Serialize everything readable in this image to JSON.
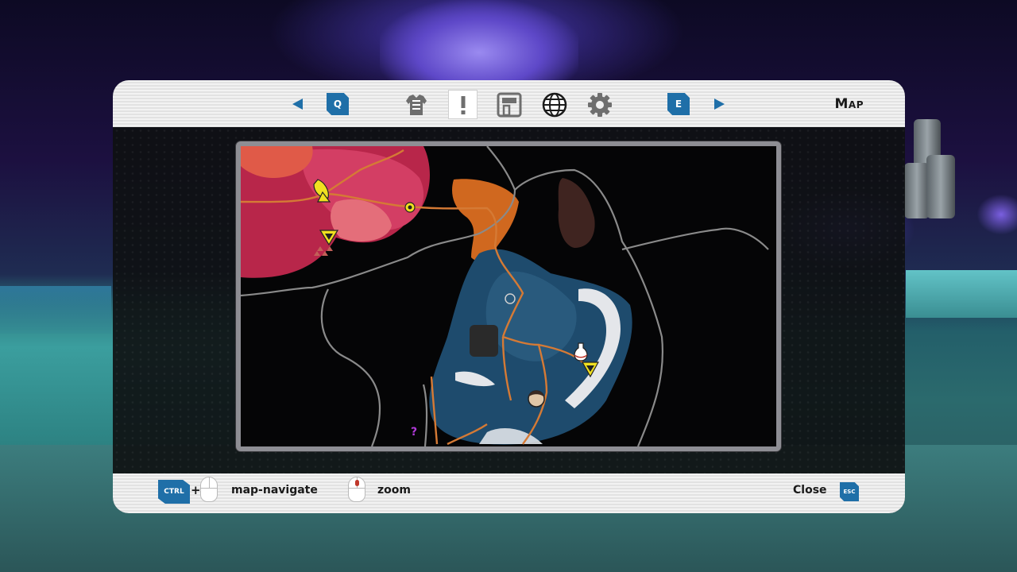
{
  "header": {
    "prev_key": "Q",
    "next_key": "E",
    "title": "Map",
    "tabs": [
      {
        "icon": "armor-icon",
        "active": false
      },
      {
        "icon": "exclamation-icon",
        "active": true
      },
      {
        "icon": "base-icon",
        "active": false
      },
      {
        "icon": "globe-icon",
        "active": false
      },
      {
        "icon": "gear-icon",
        "active": false
      }
    ]
  },
  "footer": {
    "ctrl_key": "CTRL",
    "plus": "+",
    "navigate_label": "map-navigate",
    "zoom_label": "zoom",
    "close_label": "Close",
    "esc_key": "ESC"
  },
  "map": {
    "markers": [
      {
        "icon": "satellite-dish-icon"
      },
      {
        "icon": "resource-node-icon"
      },
      {
        "icon": "downward-triangle-icon"
      },
      {
        "icon": "potion-flask-icon"
      },
      {
        "icon": "player-portrait-icon"
      },
      {
        "icon": "unknown-location-icon",
        "text": "?"
      }
    ]
  },
  "colors": {
    "accent_blue": "#1f6fa8",
    "marker_yellow": "#f0e020",
    "road_orange": "#d57a35",
    "region_border": "#8a8a8a",
    "mouse_highlight": "#c0382b"
  }
}
